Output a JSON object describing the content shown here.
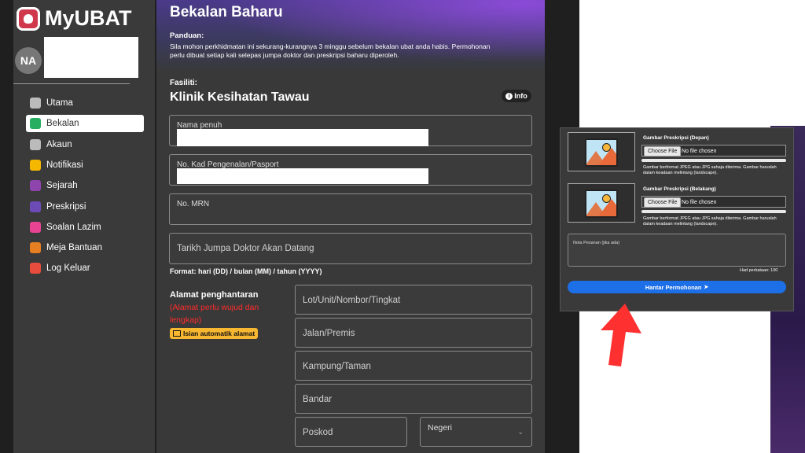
{
  "app": {
    "name": "MyUBAT",
    "avatar_initials": "NA"
  },
  "sidebar": {
    "items": [
      {
        "label": "Utama",
        "icon": "home-icon",
        "color": "#bbbbbb"
      },
      {
        "label": "Bekalan",
        "icon": "inbox-icon",
        "color": "#27ae60"
      },
      {
        "label": "Akaun",
        "icon": "user-icon",
        "color": "#bbbbbb"
      },
      {
        "label": "Notifikasi",
        "icon": "bell-icon",
        "color": "#f5b700"
      },
      {
        "label": "Sejarah",
        "icon": "history-icon",
        "color": "#8e44ad"
      },
      {
        "label": "Preskripsi",
        "icon": "document-icon",
        "color": "#6c4bb6"
      },
      {
        "label": "Soalan Lazim",
        "icon": "question-icon",
        "color": "#e84393"
      },
      {
        "label": "Meja Bantuan",
        "icon": "helpdesk-icon",
        "color": "#e67e22"
      },
      {
        "label": "Log Keluar",
        "icon": "logout-icon",
        "color": "#e74c3c"
      }
    ],
    "active_index": 1
  },
  "page": {
    "title": "Bekalan Baharu",
    "guide_label": "Panduan:",
    "guide_line1": "Sila mohon perkhidmatan ini sekurang-kurangnya 3 minggu sebelum bekalan ubat anda habis. Permohonan",
    "guide_line2": "perlu dibuat setiap kali selepas jumpa doktor dan preskripsi baharu diperoleh.",
    "facility_label": "Fasiliti:",
    "facility_name": "Klinik Kesihatan Tawau",
    "info_label": "Info"
  },
  "form": {
    "full_name_label": "Nama penuh",
    "ic_label": "No. Kad Pengenalan/Pasport",
    "mrn_label": "No. MRN",
    "appointment_placeholder": "Tarikh Jumpa Doktor Akan Datang",
    "date_format_note": "Format: hari (DD) / bulan (MM) / tahun (YYYY)",
    "address_label": "Alamat penghantaran",
    "address_note_line1": "(Alamat perlu wujud dan",
    "address_note_line2": "lengkap)",
    "auto_address_button": "Isian automatik alamat",
    "lot_placeholder": "Lot/Unit/Nombor/Tingkat",
    "street_placeholder": "Jalan/Premis",
    "village_placeholder": "Kampung/Taman",
    "city_placeholder": "Bandar",
    "postcode_placeholder": "Poskod",
    "state_label": "Negeri"
  },
  "upload": {
    "front_label": "Gambar Preskripsi (Depan)",
    "back_label": "Gambar Preskripsi (Belakang)",
    "choose_file": "Choose File",
    "no_file": "No file chosen",
    "help_line1": "Gambar berformat JPEG atau JPG sahaja diterima. Gambar haruslah",
    "help_line2": "dalam keadaan melintang (landscape).",
    "note_placeholder": "Nota Pesanan (jika ada)",
    "char_limit": "Had perkataan: 100",
    "submit_label": "Hantar Permohonan"
  },
  "colors": {
    "accent": "#1d6fe8",
    "warning": "#f7b731",
    "error": "#ff2b2b",
    "arrow": "#ff3030"
  }
}
